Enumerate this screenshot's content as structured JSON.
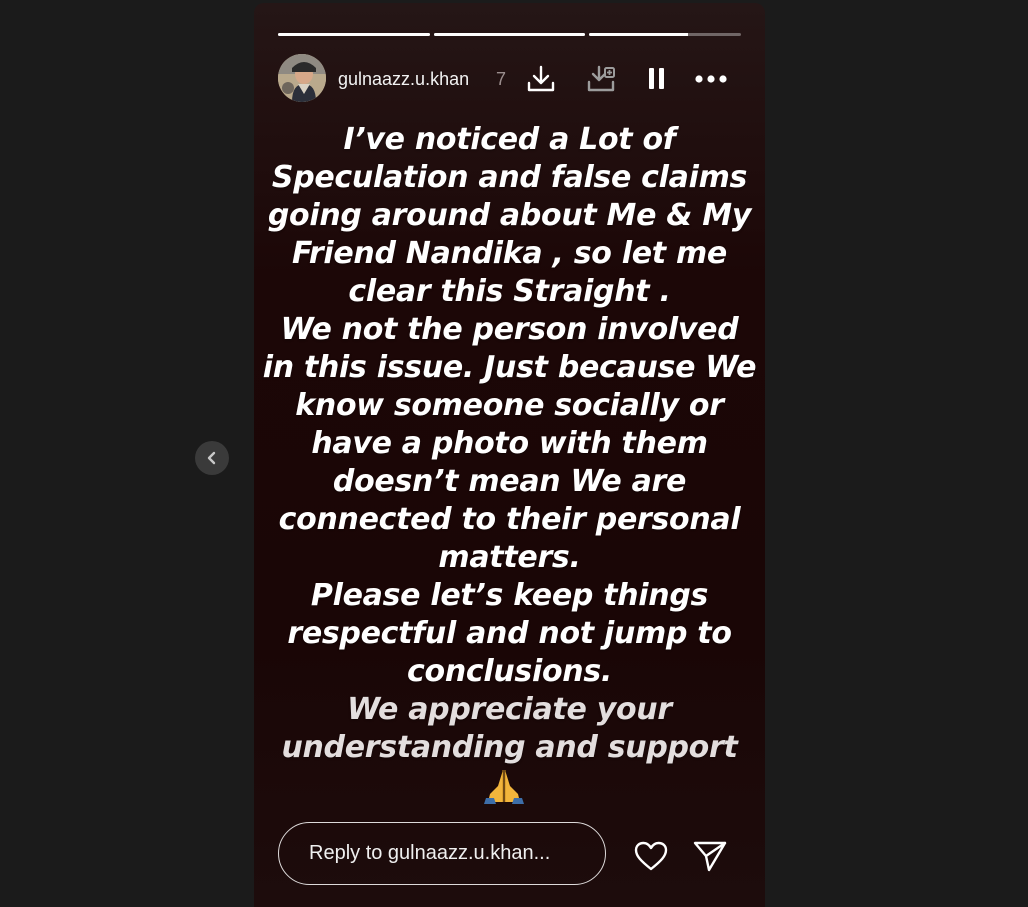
{
  "story": {
    "username": "gulnaazz.u.khan",
    "username_trail": "7",
    "progress": [
      1,
      1,
      0.65
    ],
    "text_lines": [
      "I’ve noticed a Lot of",
      "Speculation and false claims",
      "going around about Me & My",
      "Friend Nandika , so let me",
      "clear this Straight .",
      "We not the person involved",
      "in this issue. Just because We",
      "know someone socially or",
      "have a photo with them",
      "doesn’t mean We are",
      "connected to their personal",
      "matters.",
      "Please let’s keep things",
      "respectful and not jump to",
      "conclusions.",
      "We appreciate your",
      "understanding and support"
    ],
    "emoji": "🙏"
  },
  "header": {
    "icons": [
      "download-icon",
      "save-to-device-icon",
      "pause-icon",
      "more-options-icon"
    ]
  },
  "footer": {
    "reply_placeholder": "Reply to gulnaazz.u.khan..."
  },
  "nav": {
    "prev_icon": "chevron-left-icon"
  },
  "colors": {
    "page_bg": "#1b1b1b",
    "story_bg": "#1c0707",
    "text": "#ffffff"
  }
}
